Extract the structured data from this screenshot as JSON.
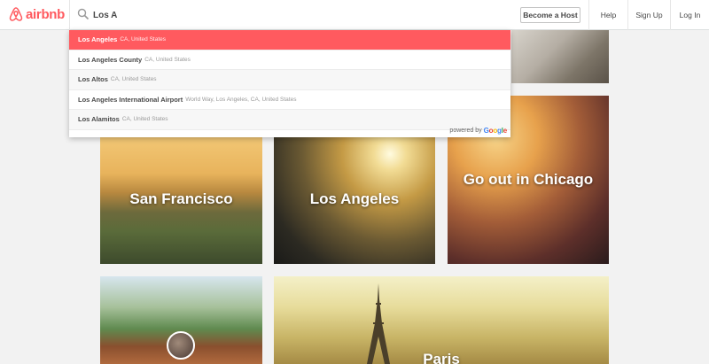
{
  "header": {
    "logo_text": "airbnb",
    "search_value": "Los A",
    "host_label": "Become a Host",
    "help_label": "Help",
    "signup_label": "Sign Up",
    "login_label": "Log In"
  },
  "dropdown": {
    "items": [
      {
        "main": "Los Angeles",
        "sub": "CA, United States"
      },
      {
        "main": "Los Angeles County",
        "sub": "CA, United States"
      },
      {
        "main": "Los Altos",
        "sub": "CA, United States"
      },
      {
        "main": "Los Angeles International Airport",
        "sub": "World Way, Los Angeles, CA, United States"
      },
      {
        "main": "Los Alamitos",
        "sub": "CA, United States"
      }
    ],
    "powered_by": "powered by",
    "google_letters": [
      "G",
      "o",
      "o",
      "g",
      "l",
      "e"
    ]
  },
  "cards": {
    "sf": "San Francisco",
    "la": "Los Angeles",
    "chicago": "Go out in Chicago",
    "paris": "Paris"
  },
  "colors": {
    "brand": "#ff5a5f",
    "text": "#484848"
  }
}
